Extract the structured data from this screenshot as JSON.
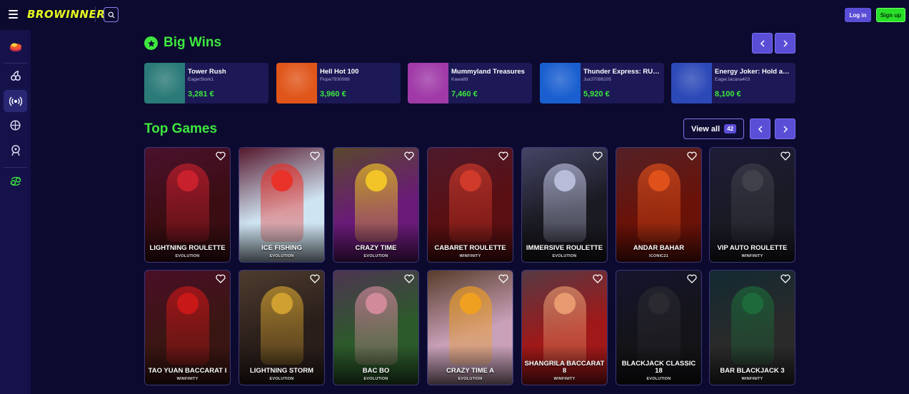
{
  "header": {
    "logo": "BROWINNER",
    "login_label": "Log in",
    "signup_label": "Sign up"
  },
  "sidebar": {
    "items": [
      {
        "icon": "casino-chips-icon"
      },
      {
        "icon": "slots-cherries-icon"
      },
      {
        "icon": "live-broadcast-icon",
        "active": true
      },
      {
        "icon": "sports-basketball-icon"
      },
      {
        "icon": "virtual-sports-icon"
      },
      {
        "icon": "zodiac-icon"
      }
    ]
  },
  "big_wins": {
    "title": "Big Wins",
    "items": [
      {
        "game": "Tower Rush",
        "user": "EagerStork1",
        "amount": "3,281 €",
        "thumb_color": "#2a7a78"
      },
      {
        "game": "Hell Hot 100",
        "user": "Flope7930089",
        "amount": "3,960 €",
        "thumb_color": "#e0561a"
      },
      {
        "game": "Mummyland Treasures",
        "user": "Kawa89",
        "amount": "7,460 €",
        "thumb_color": "#a03aa8"
      },
      {
        "game": "Thunder Express: RUN...",
        "user": "Jux37098105",
        "amount": "5,920 €",
        "thumb_color": "#1a5fd0"
      },
      {
        "game": "Energy Joker: Hold and ...",
        "user": "EagerJacana403",
        "amount": "8,100 €",
        "thumb_color": "#2c49b8"
      }
    ]
  },
  "top_games": {
    "title": "Top Games",
    "view_all_label": "View all",
    "count": "42",
    "rows": [
      [
        {
          "title": "LIGHTNING ROULETTE",
          "provider": "EVOLUTION",
          "bg": "#3a0d12",
          "accent": "#c8202c"
        },
        {
          "title": "ICE FISHING",
          "provider": "EVOLUTION",
          "bg": "#cfe4f2",
          "accent": "#e8322a"
        },
        {
          "title": "CRAZY TIME",
          "provider": "EVOLUTION",
          "bg": "#6a1a78",
          "accent": "#f2c428"
        },
        {
          "title": "CABARET ROULETTE",
          "provider": "WINFINITY",
          "bg": "#5a0f12",
          "accent": "#d03a2a"
        },
        {
          "title": "IMMERSIVE ROULETTE",
          "provider": "EVOLUTION",
          "bg": "#1a1a22",
          "accent": "#b8bcd8"
        },
        {
          "title": "ANDAR BAHAR",
          "provider": "ICONIC21",
          "bg": "#6a1208",
          "accent": "#e0501a"
        },
        {
          "title": "VIP AUTO ROULETTE",
          "provider": "WINFINITY",
          "bg": "#1a1a24",
          "accent": "#40404a"
        }
      ],
      [
        {
          "title": "TAO YUAN BACCARAT I",
          "provider": "WINFINITY",
          "bg": "#3a1612",
          "accent": "#c81818"
        },
        {
          "title": "LIGHTNING STORM",
          "provider": "EVOLUTION",
          "bg": "#2a1e1a",
          "accent": "#d0a030"
        },
        {
          "title": "BAC BO",
          "provider": "EVOLUTION",
          "bg": "#2c5a2a",
          "accent": "#d08a9a"
        },
        {
          "title": "CRAZY TIME A",
          "provider": "EVOLUTION",
          "bg": "#c8a0b8",
          "accent": "#f0a020"
        },
        {
          "title": "SHANGRILA BACCARAT 8",
          "provider": "WINFINITY",
          "bg": "#a01818",
          "accent": "#e89a70"
        },
        {
          "title": "BLACKJACK CLASSIC 18",
          "provider": "EVOLUTION",
          "bg": "#141418",
          "accent": "#2a2a30"
        },
        {
          "title": "BAR BLACKJACK 3",
          "provider": "WINFINITY",
          "bg": "#2a2a2a",
          "accent": "#1e6a3a"
        }
      ]
    ]
  }
}
